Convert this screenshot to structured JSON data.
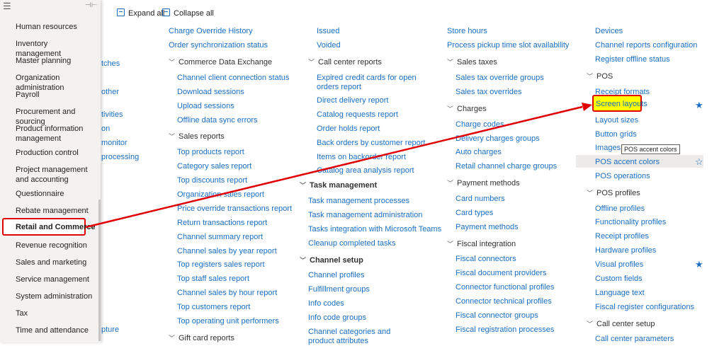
{
  "toolbar": {
    "expand_all": "Expand all",
    "collapse_all": "Collapse all"
  },
  "sidebar": {
    "items": [
      "Human resources",
      "Inventory management",
      "Master planning",
      "Organization administration",
      "Payroll",
      "Procurement and sourcing",
      "Product information management",
      "Production control",
      "Project management and accounting",
      "Questionnaire",
      "Rebate management",
      "Retail and Commerce",
      "Revenue recognition",
      "Sales and marketing",
      "Service management",
      "System administration",
      "Tax",
      "Time and attendance"
    ],
    "selected": "Retail and Commerce"
  },
  "col0": [
    "tches",
    "other",
    "tivities",
    "on",
    "monitor",
    "processing",
    "pture"
  ],
  "col1": {
    "items": [
      "Charge Override History",
      "Order synchronization status",
      "Commerce Data Exchange",
      "Channel client connection status",
      "Download sessions",
      "Upload sessions",
      "Offline data sync errors",
      "Sales reports",
      "Top products report",
      "Category sales report",
      "Top discounts report",
      "Organization sales report",
      "Price override transactions report",
      "Return transactions report",
      "Channel summary report",
      "Channel sales by year report",
      "Top registers sales report",
      "Top staff sales report",
      "Channel sales by hour report",
      "Top customers report",
      "Top operating unit performers",
      "Gift card reports"
    ]
  },
  "col2": {
    "items": [
      "Issued",
      "Voided",
      "Call center reports",
      "Expired credit cards for open orders report",
      "Direct delivery report",
      "Catalog requests report",
      "Order holds report",
      "Back orders by customer report",
      "Items on backorder report",
      "Catalog area analysis report",
      "Task management",
      "Task management processes",
      "Task management administration",
      "Tasks integration with Microsoft Teams",
      "Cleanup completed tasks",
      "Channel setup",
      "Channel profiles",
      "Fulfillment groups",
      "Info codes",
      "Info code groups",
      "Channel categories and product attributes"
    ]
  },
  "col3": {
    "items": [
      "Store hours",
      "Process pickup time slot availability",
      "Sales taxes",
      "Sales tax override groups",
      "Sales tax overrides",
      "Charges",
      "Charge codes",
      "Delivery charges groups",
      "Auto charges",
      "Retail channel charge groups",
      "Payment methods",
      "Card numbers",
      "Card types",
      "Payment methods",
      "Fiscal integration",
      "Fiscal connectors",
      "Fiscal document providers",
      "Connector functional profiles",
      "Connector technical profiles",
      "Fiscal connector groups",
      "Fiscal registration processes"
    ]
  },
  "col4": {
    "items": [
      "Devices",
      "Channel reports configuration",
      "Register offline status",
      "POS",
      "Receipt formats",
      "Screen layouts",
      "Layout sizes",
      "Button grids",
      "Images",
      "POS accent colors",
      "POS operations",
      "POS profiles",
      "Offline profiles",
      "Functionality profiles",
      "Receipt profiles",
      "Hardware profiles",
      "Visual profiles",
      "Custom fields",
      "Language text",
      "Fiscal register configurations",
      "Call center setup",
      "Call center parameters"
    ],
    "tooltip": "POS accent colors"
  },
  "icons": {
    "menu": "hamburger-icon",
    "pin": "pin-icon",
    "chevron": "chevron-down-icon",
    "star": "star-icon"
  },
  "colors": {
    "link": "#1b6ec2",
    "highlight": "#ffff00",
    "annotation": "#e00000",
    "star": "#1b6ec2"
  }
}
